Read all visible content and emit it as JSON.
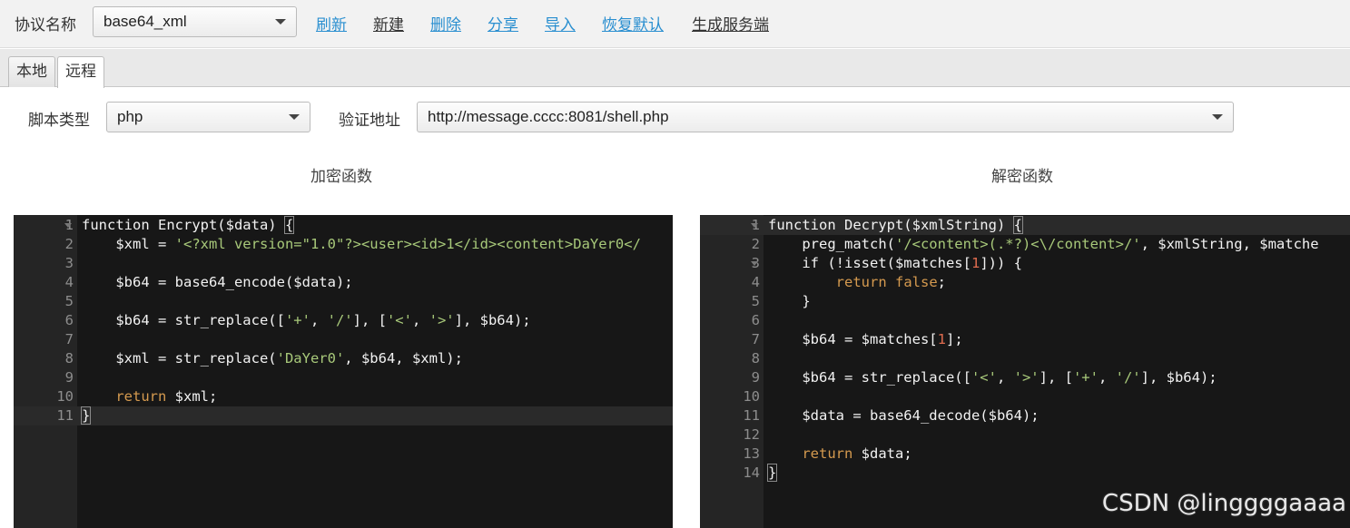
{
  "toolbar": {
    "protocol_label": "协议名称",
    "protocol_value": "base64_xml",
    "links": [
      "刷新",
      "新建",
      "删除",
      "分享",
      "导入",
      "恢复默认",
      "生成服务端"
    ]
  },
  "tabs": [
    "本地",
    "远程"
  ],
  "form": {
    "script_type_label": "脚本类型",
    "script_type_value": "php",
    "verify_url_label": "验证地址",
    "verify_url_value": "http://message.cccc:8081/shell.php"
  },
  "encrypt": {
    "title": "加密函数",
    "lines": [
      "function Encrypt($data) {",
      "    $xml = '<?xml version=\"1.0\"?><user><id>1</id><content>DaYer0</",
      "",
      "    $b64 = base64_encode($data);",
      "",
      "    $b64 = str_replace(['+', '/'], ['<', '>'], $b64);",
      "",
      "    $xml = str_replace('DaYer0', $b64, $xml);",
      "",
      "    return $xml;",
      "}"
    ]
  },
  "decrypt": {
    "title": "解密函数",
    "lines": [
      "function Decrypt($xmlString) {",
      "    preg_match('/<content>(.*?)<\\/content>/', $xmlString, $matche",
      "    if (!isset($matches[1])) {",
      "        return false;",
      "    }",
      "",
      "    $b64 = $matches[1];",
      "",
      "    $b64 = str_replace(['<', '>'], ['+', '/'], $b64);",
      "",
      "    $data = base64_decode($b64);",
      "",
      "    return $data;",
      "}"
    ]
  },
  "watermark": "CSDN @linggggaaaa"
}
